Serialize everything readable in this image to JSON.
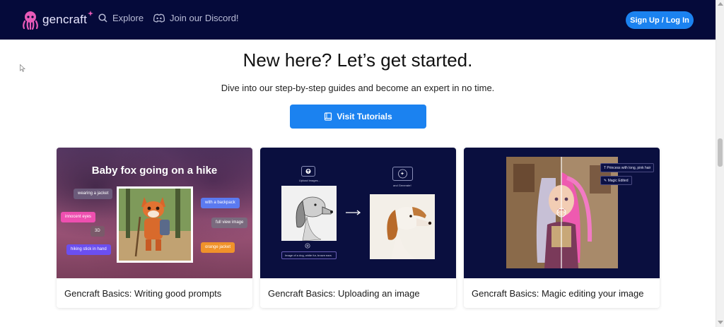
{
  "header": {
    "logo_text": "gencraft",
    "nav": [
      {
        "label": "Explore",
        "icon": "search-icon"
      },
      {
        "label": "Join our Discord!",
        "icon": "discord-icon"
      }
    ],
    "signup_label": "Sign Up / Log In"
  },
  "hero": {
    "title": "New here? Let’s get started.",
    "subtitle": "Dive into our step-by-step guides and become an expert in no time.",
    "button_label": "Visit Tutorials",
    "button_icon": "book-icon"
  },
  "cards": [
    {
      "title": "Gencraft Basics: Writing good prompts",
      "image_heading": "Baby fox going on a hike",
      "tags": [
        "wearing a jacket",
        "innocent eyes",
        "3D",
        "hiking stick in hand",
        "with a backpack",
        "full view image",
        "orange jacket"
      ]
    },
    {
      "title": "Gencraft Basics: Uploading an image",
      "upload_label": "Upload images...",
      "generate_label": "and Generate!",
      "prompt_text": "Image of a dog, white fur, brown ears"
    },
    {
      "title": "Gencraft Basics: Magic editing your image",
      "prompt_tag": "Princess with long, pink hair",
      "edit_tag": "Magic Edited"
    }
  ],
  "colors": {
    "header_bg": "#050a3a",
    "accent": "#1b82f0",
    "card_dark_bg": "#0a0f3f"
  }
}
